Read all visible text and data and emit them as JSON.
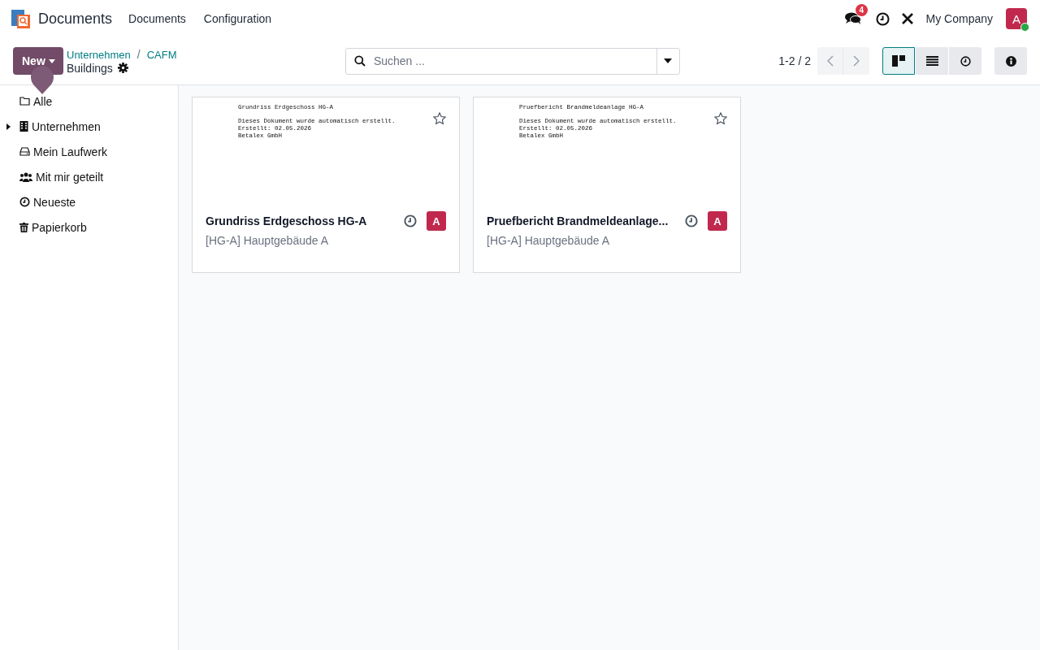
{
  "navbar": {
    "app_name": "Documents",
    "menu": [
      "Documents",
      "Configuration"
    ],
    "messages_count": "4",
    "company": "My Company",
    "avatar": "A",
    "online": true
  },
  "control_panel": {
    "new_button": "New",
    "breadcrumbs": [
      "Unternehmen",
      "CAFM"
    ],
    "breadcrumb_separator": "/",
    "title": "Buildings",
    "search": {
      "placeholder": "Suchen ..."
    },
    "pager": "1-2 / 2",
    "views": [
      {
        "kind": "kanban",
        "selected": true
      },
      {
        "kind": "list",
        "selected": false
      },
      {
        "kind": "activity",
        "selected": false
      }
    ]
  },
  "sidebar": {
    "items": [
      {
        "label": "Alle",
        "kind": "folder"
      },
      {
        "label": "Unternehmen",
        "kind": "building",
        "expanded": false
      },
      {
        "label": "Mein Laufwerk",
        "kind": "drive"
      },
      {
        "label": "Mit mir geteilt",
        "kind": "users"
      },
      {
        "label": "Neueste",
        "kind": "clock"
      },
      {
        "label": "Papierkorb",
        "kind": "trash"
      }
    ]
  },
  "cards": [
    {
      "preview": [
        "Grundriss Erdgeschoss HG-A",
        "Dieses Dokument wurde automatisch erstellt.",
        "Erstellt: 02.05.2026",
        "Betalex GmbH"
      ],
      "name": "Grundriss Erdgeschoss HG-A",
      "folder": "[HG-A] Hauptgebäude A",
      "starred": false,
      "owner": "A"
    },
    {
      "preview": [
        "Pruefbericht Brandmeldeanlage HG-A",
        "Dieses Dokument wurde automatisch erstellt.",
        "Erstellt: 02.05.2026",
        "Betalex GmbH"
      ],
      "name": "Pruefbericht Brandmeldeanlage...",
      "folder": "[HG-A] Hauptgebäude A",
      "starred": false,
      "owner": "A"
    }
  ]
}
